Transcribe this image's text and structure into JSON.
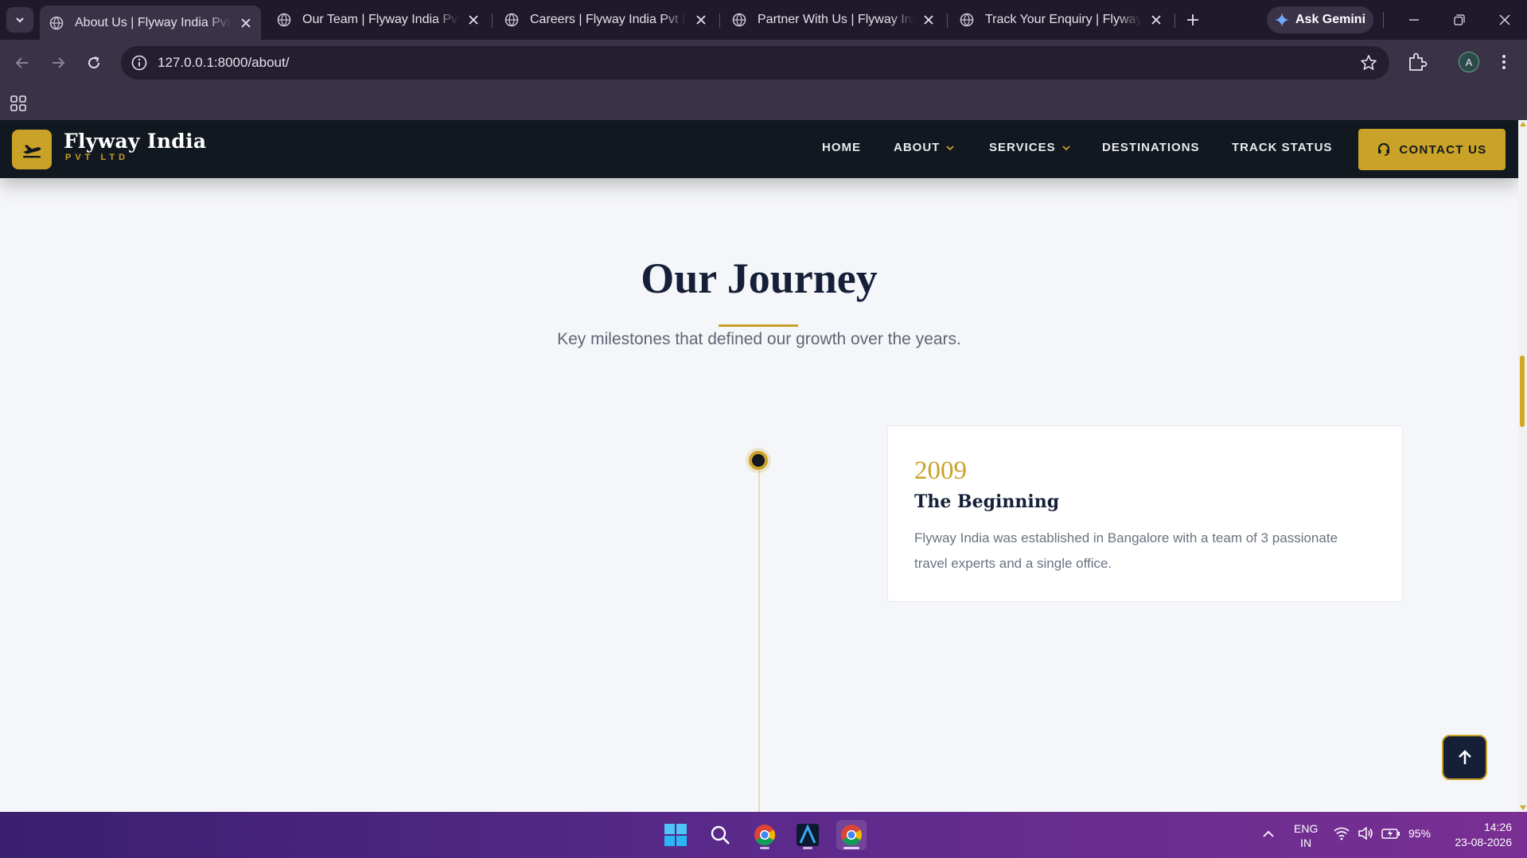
{
  "browser": {
    "tabs": [
      {
        "title": "About Us | Flyway India Pvt Ltd",
        "active": true
      },
      {
        "title": "Our Team | Flyway India Pvt Ltd",
        "active": false
      },
      {
        "title": "Careers | Flyway India Pvt Ltd",
        "active": false
      },
      {
        "title": "Partner With Us | Flyway India",
        "active": false
      },
      {
        "title": "Track Your Enquiry | Flyway India",
        "active": false
      }
    ],
    "gemini_label": "Ask Gemini",
    "url": "127.0.0.1:8000/about/",
    "profile_initial": "A"
  },
  "site": {
    "brand_name": "Flyway India",
    "brand_sub": "PVT LTD",
    "nav": {
      "home": "HOME",
      "about": "ABOUT",
      "services": "SERVICES",
      "destinations": "DESTINATIONS",
      "track_status": "TRACK STATUS"
    },
    "contact_label": "CONTACT US",
    "accent_color": "#c9a227",
    "dark_color": "#121820"
  },
  "journey": {
    "title": "Our Journey",
    "subtitle": "Key milestones that defined our growth over the years.",
    "milestones": [
      {
        "year": "2009",
        "heading": "The Beginning",
        "description": "Flyway India was established in Bangalore with a team of 3 passionate travel experts and a single office."
      }
    ]
  },
  "taskbar": {
    "lang_line1": "ENG",
    "lang_line2": "IN",
    "battery": "95%",
    "time": "14:26",
    "date": "23-08-2026"
  }
}
